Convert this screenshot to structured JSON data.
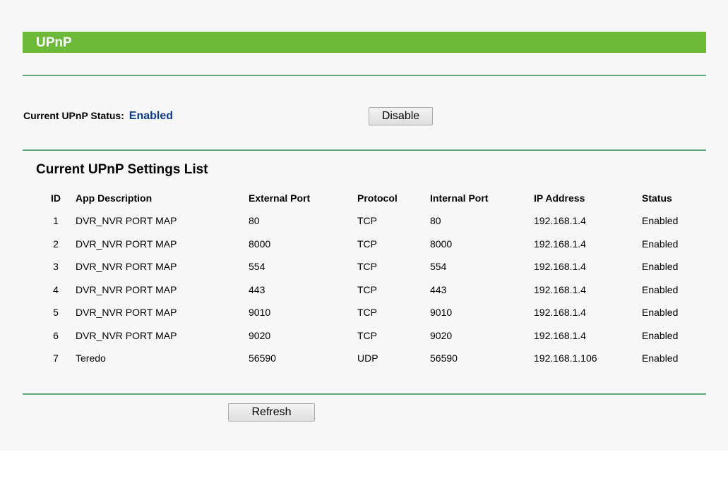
{
  "header": {
    "title": "UPnP"
  },
  "status": {
    "label": "Current UPnP Status:",
    "value": "Enabled",
    "toggle_button": "Disable"
  },
  "settings_list": {
    "title": "Current UPnP Settings List",
    "columns": [
      "ID",
      "App Description",
      "External Port",
      "Protocol",
      "Internal Port",
      "IP Address",
      "Status"
    ],
    "rows": [
      [
        "1",
        "DVR_NVR PORT MAP",
        "80",
        "TCP",
        "80",
        "192.168.1.4",
        "Enabled"
      ],
      [
        "2",
        "DVR_NVR PORT MAP",
        "8000",
        "TCP",
        "8000",
        "192.168.1.4",
        "Enabled"
      ],
      [
        "3",
        "DVR_NVR PORT MAP",
        "554",
        "TCP",
        "554",
        "192.168.1.4",
        "Enabled"
      ],
      [
        "4",
        "DVR_NVR PORT MAP",
        "443",
        "TCP",
        "443",
        "192.168.1.4",
        "Enabled"
      ],
      [
        "5",
        "DVR_NVR PORT MAP",
        "9010",
        "TCP",
        "9010",
        "192.168.1.4",
        "Enabled"
      ],
      [
        "6",
        "DVR_NVR PORT MAP",
        "9020",
        "TCP",
        "9020",
        "192.168.1.4",
        "Enabled"
      ],
      [
        "7",
        "Teredo",
        "56590",
        "UDP",
        "56590",
        "192.168.1.106",
        "Enabled"
      ]
    ]
  },
  "footer": {
    "refresh_button": "Refresh"
  },
  "colors": {
    "title_bar": "#6cba38",
    "divider": "#5aa87c",
    "status_enabled": "#0d3d8c",
    "panel_background": "#f7f7f7"
  }
}
